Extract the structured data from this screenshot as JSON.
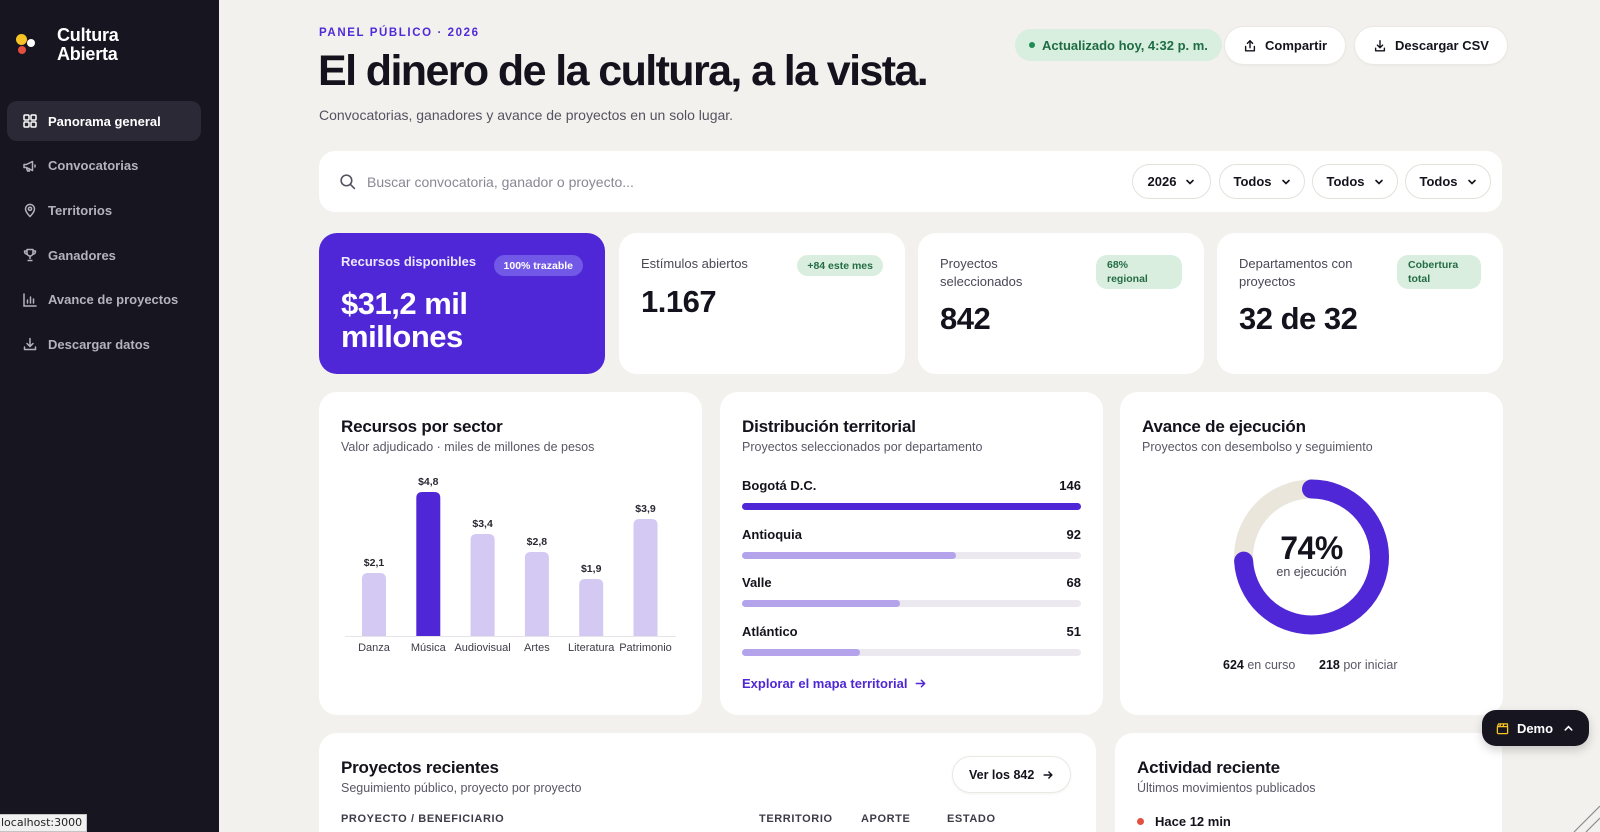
{
  "brand": {
    "line1": "Cultura",
    "line2": "Abierta"
  },
  "sidebar": {
    "items": [
      {
        "label": "Panorama general",
        "icon": "grid-icon",
        "active": true
      },
      {
        "label": "Convocatorias",
        "icon": "megaphone-icon",
        "active": false
      },
      {
        "label": "Territorios",
        "icon": "map-pin-icon",
        "active": false
      },
      {
        "label": "Ganadores",
        "icon": "trophy-icon",
        "active": false
      },
      {
        "label": "Avance de proyectos",
        "icon": "bar-chart-icon",
        "active": false
      },
      {
        "label": "Descargar datos",
        "icon": "download-icon",
        "active": false
      }
    ]
  },
  "status_bar": {
    "url": "localhost:3000"
  },
  "header": {
    "eyebrow": "PANEL PÚBLICO · 2026",
    "title": "El dinero de la cultura, a la vista.",
    "subtitle": "Convocatorias, ganadores y avance de proyectos en un solo lugar.",
    "status": "Actualizado hoy, 4:32 p. m.",
    "share_label": "Compartir",
    "csv_label": "Descargar CSV"
  },
  "filters": {
    "search_placeholder": "Buscar convocatoria, ganador o proyecto...",
    "search_value": "",
    "year": "2026",
    "filter2": "Todos",
    "filter3": "Todos",
    "filter4": "Todos"
  },
  "kpis": [
    {
      "label": "Recursos disponibles",
      "badge": "100% trazable",
      "value": "$31,2 mil millones"
    },
    {
      "label": "Estímulos abiertos",
      "badge": "+84 este mes",
      "value": "1.167"
    },
    {
      "label": "Proyectos seleccionados",
      "badge": "68% regional",
      "value": "842"
    },
    {
      "label": "Departamentos con proyectos",
      "badge": "Cobertura total",
      "value": "32 de 32"
    }
  ],
  "sector_panel": {
    "title": "Recursos por sector",
    "subtitle": "Valor adjudicado · miles de millones de pesos"
  },
  "chart_data": {
    "type": "bar",
    "categories": [
      "Danza",
      "Música",
      "Audiovisual",
      "Artes",
      "Literatura",
      "Patrimonio"
    ],
    "values": [
      2.1,
      4.8,
      3.4,
      2.8,
      1.9,
      3.9
    ],
    "data_labels": [
      "$2,1",
      "$4,8",
      "$3,4",
      "$2,8",
      "$1,9",
      "$3,9"
    ],
    "highlight": "Música",
    "ylim": [
      0,
      4.8
    ],
    "grid": false,
    "colors": {
      "default": "#d3c9f3",
      "highlight": "#4f27d6"
    }
  },
  "territory_panel": {
    "title": "Distribución territorial",
    "subtitle": "Proyectos seleccionados por departamento",
    "rows": [
      {
        "name": "Bogotá D.C.",
        "value": 146
      },
      {
        "name": "Antioquia",
        "value": 92
      },
      {
        "name": "Valle",
        "value": 68
      },
      {
        "name": "Atlántico",
        "value": 51
      }
    ],
    "link": "Explorar el mapa territorial"
  },
  "execution_panel": {
    "title": "Avance de ejecución",
    "subtitle": "Proyectos con desembolso y seguimiento",
    "percent": 74,
    "percent_label": "74%",
    "center_label": "en ejecución",
    "in_progress_value": "624",
    "in_progress_label": "en curso",
    "pending_value": "218",
    "pending_label": "por iniciar"
  },
  "recent_projects": {
    "title": "Proyectos recientes",
    "subtitle": "Seguimiento público, proyecto por proyecto",
    "button": "Ver los 842",
    "columns": [
      "PROYECTO / BENEFICIARIO",
      "TERRITORIO",
      "APORTE",
      "ESTADO"
    ]
  },
  "activity": {
    "title": "Actividad reciente",
    "subtitle": "Últimos movimientos publicados",
    "first_item": "Hace 12 min"
  },
  "demo": {
    "label": "Demo"
  },
  "colors": {
    "accent": "#4f27d6",
    "sidebar_bg": "#17151f",
    "page_bg": "#f3f1ed",
    "success_bg": "#d8eedf",
    "success_text": "#1e6c43",
    "alert": "#e4503f"
  }
}
